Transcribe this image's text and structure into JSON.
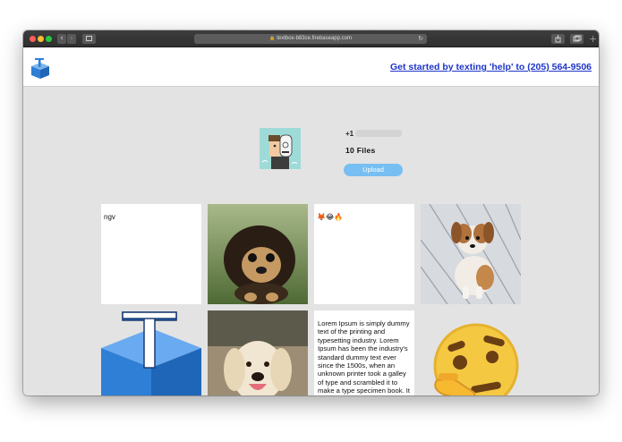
{
  "browser": {
    "url": "textbox-b83ce.firebaseapp.com",
    "back_label": "‹",
    "forward_label": "›",
    "new_tab_label": "+"
  },
  "header": {
    "cta_text": "Get started by texting 'help' to (205) 564-9506"
  },
  "profile": {
    "phone_prefix": "+1",
    "files_count": "10 Files",
    "upload_label": "Upload"
  },
  "tiles": [
    {
      "type": "text",
      "text": "ngv"
    },
    {
      "type": "image",
      "subject": "fluffy black and tan puppy"
    },
    {
      "type": "text",
      "text": "🦊😂🔥"
    },
    {
      "type": "image",
      "subject": "brown and white puppy on wooden deck"
    },
    {
      "type": "image",
      "subject": "blue textbox logo"
    },
    {
      "type": "image",
      "subject": "golden retriever puppy"
    },
    {
      "type": "text",
      "text": "Lorem Ipsum is simply dummy text of the printing and typesetting industry. Lorem Ipsum has been the industry's standard dummy text ever since the 1500s, when an unknown printer took a galley of type and scrambled it to make a type specimen book. It has survived not only five"
    },
    {
      "type": "image",
      "subject": "thinking face emoji"
    }
  ],
  "colors": {
    "page_bg": "#e3e3e3",
    "cta_link": "#1d35c8",
    "upload_button": "#77bff2",
    "logo_blue": "#2f7fd6"
  }
}
